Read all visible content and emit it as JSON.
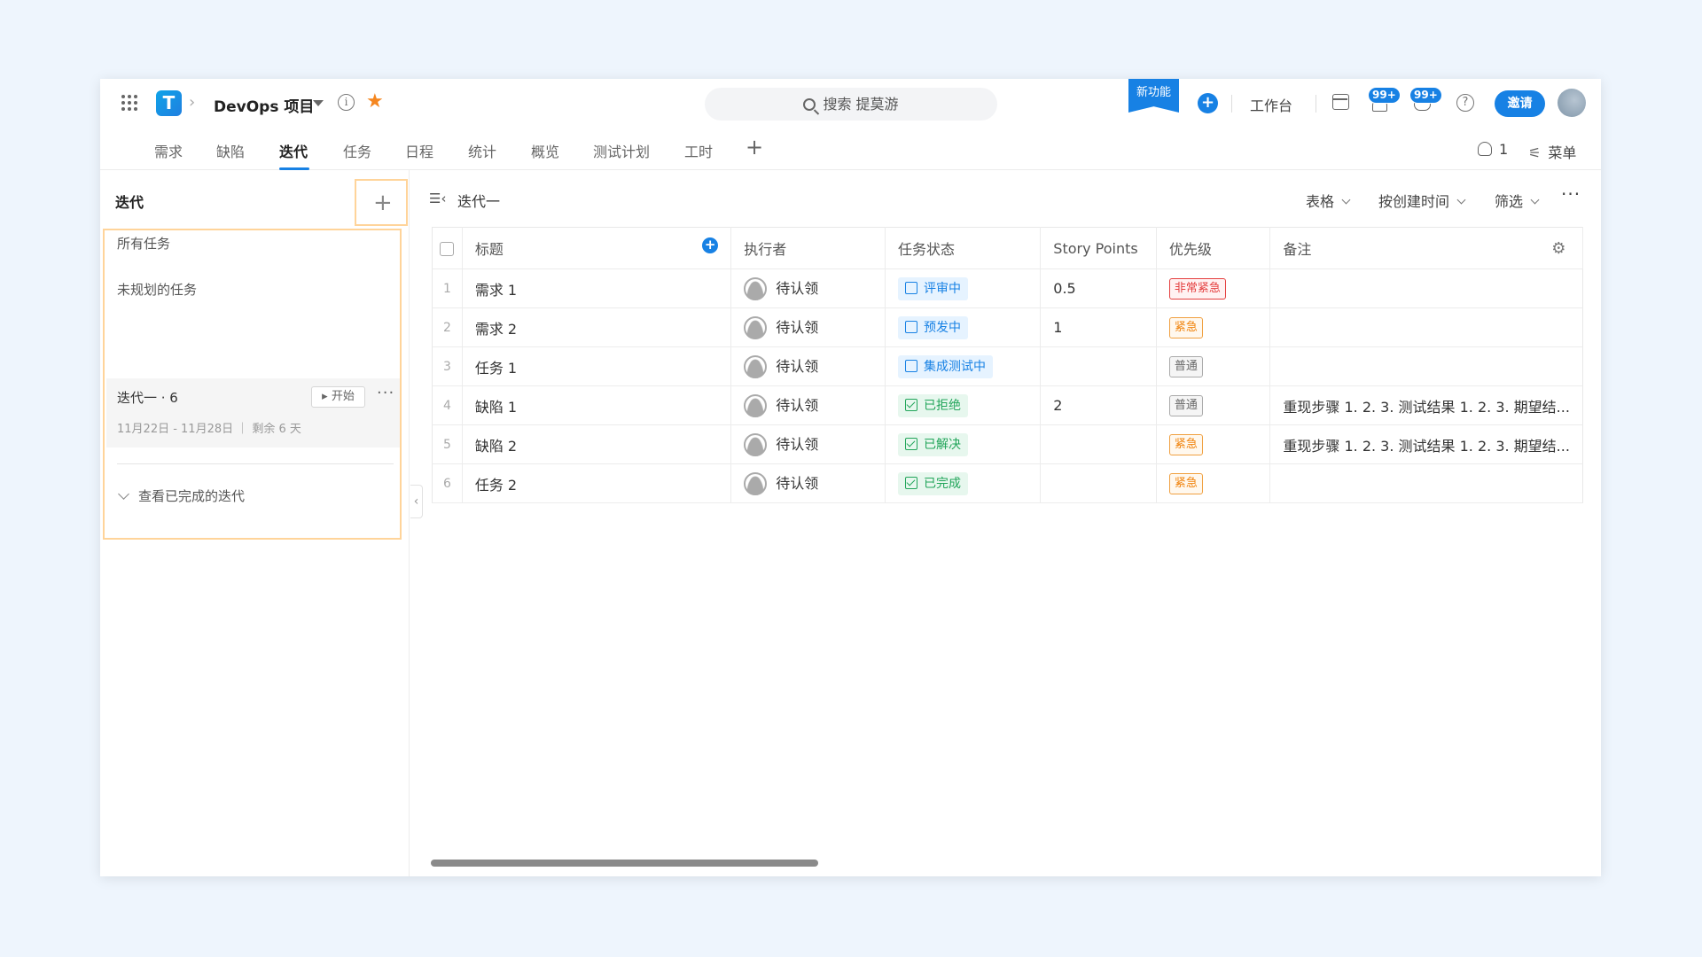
{
  "header": {
    "project_name": "DevOps 项目",
    "search_placeholder": "搜索 提莫游",
    "new_feature_label": "新功能",
    "workbench_label": "工作台",
    "notifications_badge": "99+",
    "messages_badge": "99+",
    "invite_label": "邀请"
  },
  "nav": {
    "tabs": [
      "需求",
      "缺陷",
      "迭代",
      "任务",
      "日程",
      "统计",
      "概览",
      "测试计划",
      "工时"
    ],
    "active_tab": "迭代",
    "member_count": "1",
    "menu_label": "菜单"
  },
  "sidebar": {
    "title": "迭代",
    "all_tasks": "所有任务",
    "unplanned": "未规划的任务",
    "iteration": {
      "name": "迭代一 · 6",
      "start_label": "开始",
      "dates": "11月22日 - 11月28日 ｜ 剩余 6 天"
    },
    "view_completed": "查看已完成的迭代"
  },
  "main": {
    "title": "迭代一",
    "view_label": "表格",
    "sort_label": "按创建时间",
    "filter_label": "筛选",
    "columns": [
      "标题",
      "执行者",
      "任务状态",
      "Story Points",
      "优先级",
      "备注"
    ],
    "rows": [
      {
        "num": "1",
        "title": "需求 1",
        "assignee": "待认领",
        "status": "评审中",
        "status_color": "blue",
        "points": "0.5",
        "priority": "非常紧急",
        "priority_color": "red",
        "note": ""
      },
      {
        "num": "2",
        "title": "需求 2",
        "assignee": "待认领",
        "status": "预发中",
        "status_color": "blue",
        "points": "1",
        "priority": "紧急",
        "priority_color": "orange",
        "note": ""
      },
      {
        "num": "3",
        "title": "任务 1",
        "assignee": "待认领",
        "status": "集成测试中",
        "status_color": "blue",
        "points": "",
        "priority": "普通",
        "priority_color": "gray",
        "note": ""
      },
      {
        "num": "4",
        "title": "缺陷 1",
        "assignee": "待认领",
        "status": "已拒绝",
        "status_color": "green",
        "points": "2",
        "priority": "普通",
        "priority_color": "gray",
        "note": "重现步骤 1. 2. 3. 测试结果 1. 2. 3. 期望结..."
      },
      {
        "num": "5",
        "title": "缺陷 2",
        "assignee": "待认领",
        "status": "已解决",
        "status_color": "green",
        "points": "",
        "priority": "紧急",
        "priority_color": "orange",
        "note": "重现步骤 1. 2. 3. 测试结果 1. 2. 3. 期望结..."
      },
      {
        "num": "6",
        "title": "任务 2",
        "assignee": "待认领",
        "status": "已完成",
        "status_color": "green",
        "points": "",
        "priority": "紧急",
        "priority_color": "orange",
        "note": ""
      }
    ]
  },
  "colors": {
    "accent": "#1781e4",
    "highlight_border": "#ffd49a",
    "star": "#f5861f"
  }
}
